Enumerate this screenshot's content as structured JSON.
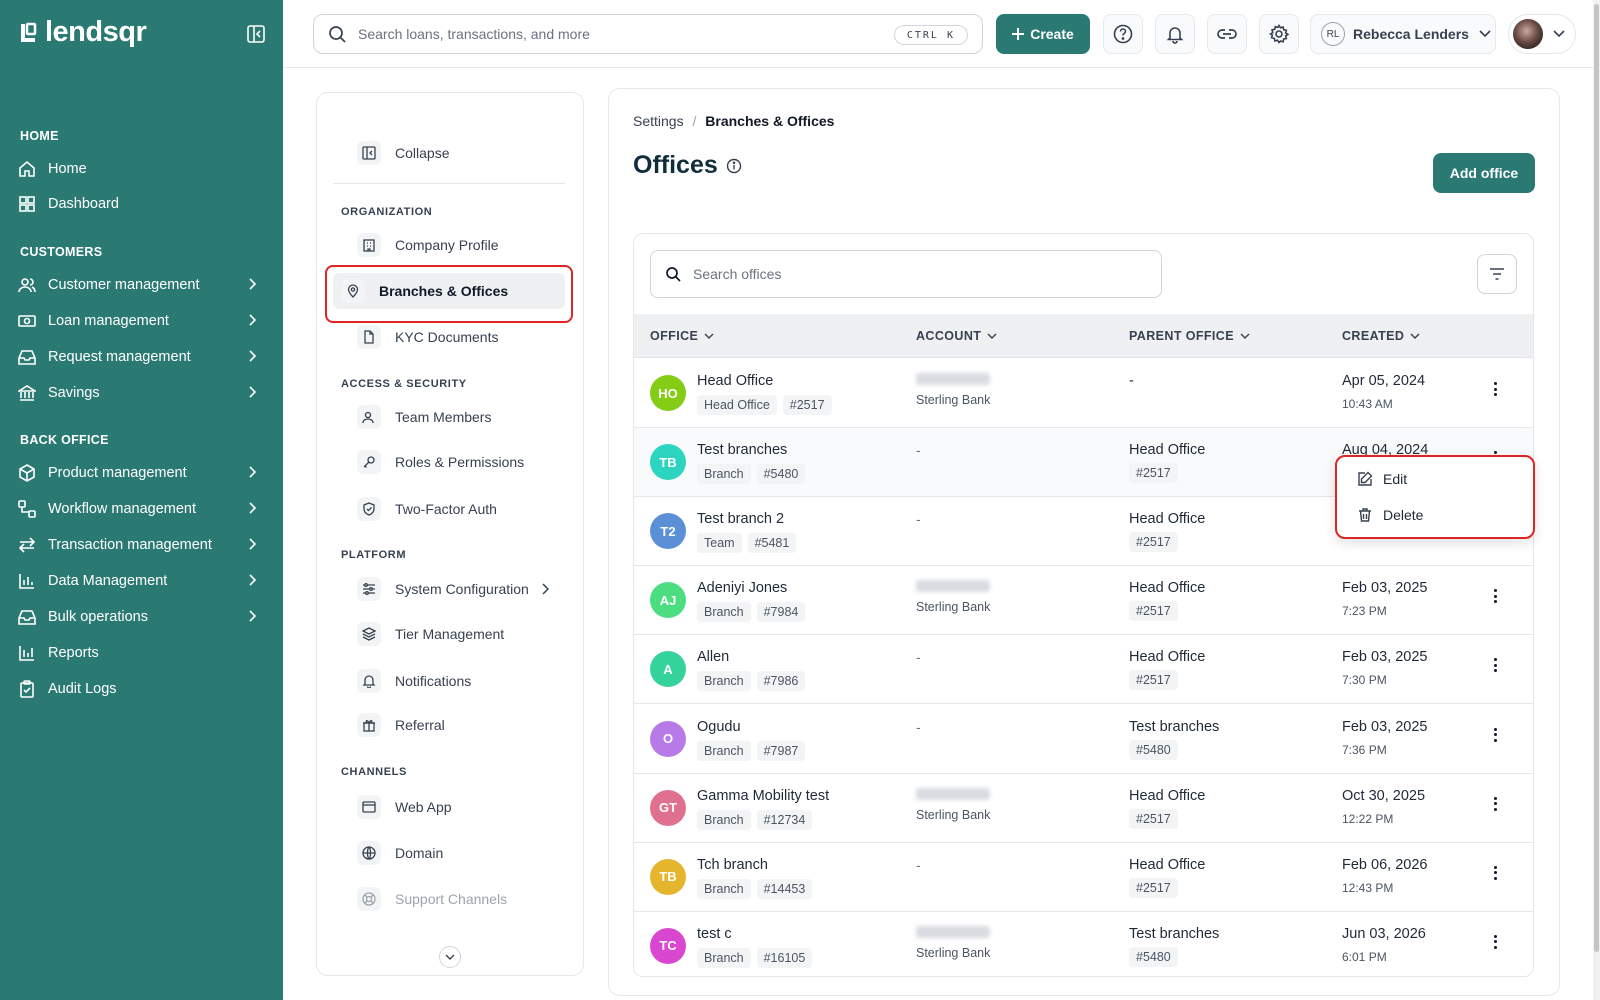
{
  "brand": {
    "name": "lendsqr"
  },
  "sidebar": {
    "sections": [
      {
        "label": "HOME",
        "items": [
          {
            "label": "Home",
            "icon": "home-icon"
          },
          {
            "label": "Dashboard",
            "icon": "dashboard-icon"
          }
        ]
      },
      {
        "label": "CUSTOMERS",
        "items": [
          {
            "label": "Customer management",
            "icon": "users-icon"
          },
          {
            "label": "Loan management",
            "icon": "cash-icon"
          },
          {
            "label": "Request management",
            "icon": "inbox-icon"
          },
          {
            "label": "Savings",
            "icon": "bank-icon"
          }
        ]
      },
      {
        "label": "BACK OFFICE",
        "items": [
          {
            "label": "Product management",
            "icon": "box-icon"
          },
          {
            "label": "Workflow management",
            "icon": "workflow-icon"
          },
          {
            "label": "Transaction management",
            "icon": "transfer-icon"
          },
          {
            "label": "Data Management",
            "icon": "chart-icon"
          },
          {
            "label": "Bulk operations",
            "icon": "inbox-icon"
          },
          {
            "label": "Reports",
            "icon": "reports-icon"
          },
          {
            "label": "Audit Logs",
            "icon": "clipboard-icon"
          }
        ]
      }
    ]
  },
  "topbar": {
    "search_placeholder": "Search loans, transactions, and more",
    "shortcut": "CTRL K",
    "create_label": "Create",
    "user_initials": "RL",
    "user_name": "Rebecca Lenders"
  },
  "settings_nav": {
    "collapse": "Collapse",
    "sections": {
      "organization": "ORGANIZATION",
      "access": "ACCESS & SECURITY",
      "platform": "PLATFORM",
      "channels": "CHANNELS"
    },
    "items": {
      "company_profile": "Company Profile",
      "branches": "Branches & Offices",
      "kyc": "KYC Documents",
      "team": "Team Members",
      "roles": "Roles & Permissions",
      "twofa": "Two-Factor Auth",
      "sysconfig": "System Configuration",
      "tier": "Tier Management",
      "notifications": "Notifications",
      "referral": "Referral",
      "webapp": "Web App",
      "domain": "Domain",
      "support": "Support Channels"
    }
  },
  "main": {
    "breadcrumb": {
      "parent": "Settings",
      "separator": "/",
      "current": "Branches & Offices"
    },
    "title": "Offices",
    "add_label": "Add office",
    "search_placeholder": "Search offices",
    "columns": [
      "OFFICE",
      "ACCOUNT",
      "PARENT OFFICE",
      "CREATED"
    ],
    "rows": [
      {
        "initials": "HO",
        "color": "#84cc16",
        "name": "Head Office",
        "type": "Head Office",
        "id": "#2517",
        "account": "masked",
        "bank": "Sterling Bank",
        "parent": "-",
        "parent_id": "",
        "date": "Apr 05, 2024",
        "time": "10:43 AM"
      },
      {
        "initials": "TB",
        "color": "#2dd4bf",
        "name": "Test branches",
        "type": "Branch",
        "id": "#5480",
        "account": "-",
        "bank": "",
        "parent": "Head Office",
        "parent_id": "#2517",
        "date": "Aug 04, 2024",
        "time": ""
      },
      {
        "initials": "T2",
        "color": "#5b8fd6",
        "name": "Test branch 2",
        "type": "Team",
        "id": "#5481",
        "account": "-",
        "bank": "",
        "parent": "Head Office",
        "parent_id": "#2517",
        "date": "",
        "time": ""
      },
      {
        "initials": "AJ",
        "color": "#4ade80",
        "name": "Adeniyi Jones",
        "type": "Branch",
        "id": "#7984",
        "account": "masked",
        "bank": "Sterling Bank",
        "parent": "Head Office",
        "parent_id": "#2517",
        "date": "Feb 03, 2025",
        "time": "7:23 PM"
      },
      {
        "initials": "A",
        "color": "#34d399",
        "name": "Allen",
        "type": "Branch",
        "id": "#7986",
        "account": "-",
        "bank": "",
        "parent": "Head Office",
        "parent_id": "#2517",
        "date": "Feb 03, 2025",
        "time": "7:30 PM"
      },
      {
        "initials": "O",
        "color": "#b87ae6",
        "name": "Ogudu",
        "type": "Branch",
        "id": "#7987",
        "account": "-",
        "bank": "",
        "parent": "Test branches",
        "parent_id": "#5480",
        "date": "Feb 03, 2025",
        "time": "7:36 PM"
      },
      {
        "initials": "GT",
        "color": "#e0708f",
        "name": "Gamma Mobility test",
        "type": "Branch",
        "id": "#12734",
        "account": "masked",
        "bank": "Sterling Bank",
        "parent": "Head Office",
        "parent_id": "#2517",
        "date": "Oct 30, 2025",
        "time": "12:22 PM"
      },
      {
        "initials": "TB",
        "color": "#e6b52e",
        "name": "Tch branch",
        "type": "Branch",
        "id": "#14453",
        "account": "-",
        "bank": "",
        "parent": "Head Office",
        "parent_id": "#2517",
        "date": "Feb 06, 2026",
        "time": "12:43 PM"
      },
      {
        "initials": "TC",
        "color": "#d946d0",
        "name": "test c",
        "type": "Branch",
        "id": "#16105",
        "account": "masked",
        "bank": "Sterling Bank",
        "parent": "Test branches",
        "parent_id": "#5480",
        "date": "Jun 03, 2026",
        "time": "6:01 PM"
      }
    ],
    "row_menu": {
      "edit": "Edit",
      "delete": "Delete"
    }
  },
  "colors": {
    "brand": "#2a7a73",
    "highlight": "#dc2626"
  }
}
